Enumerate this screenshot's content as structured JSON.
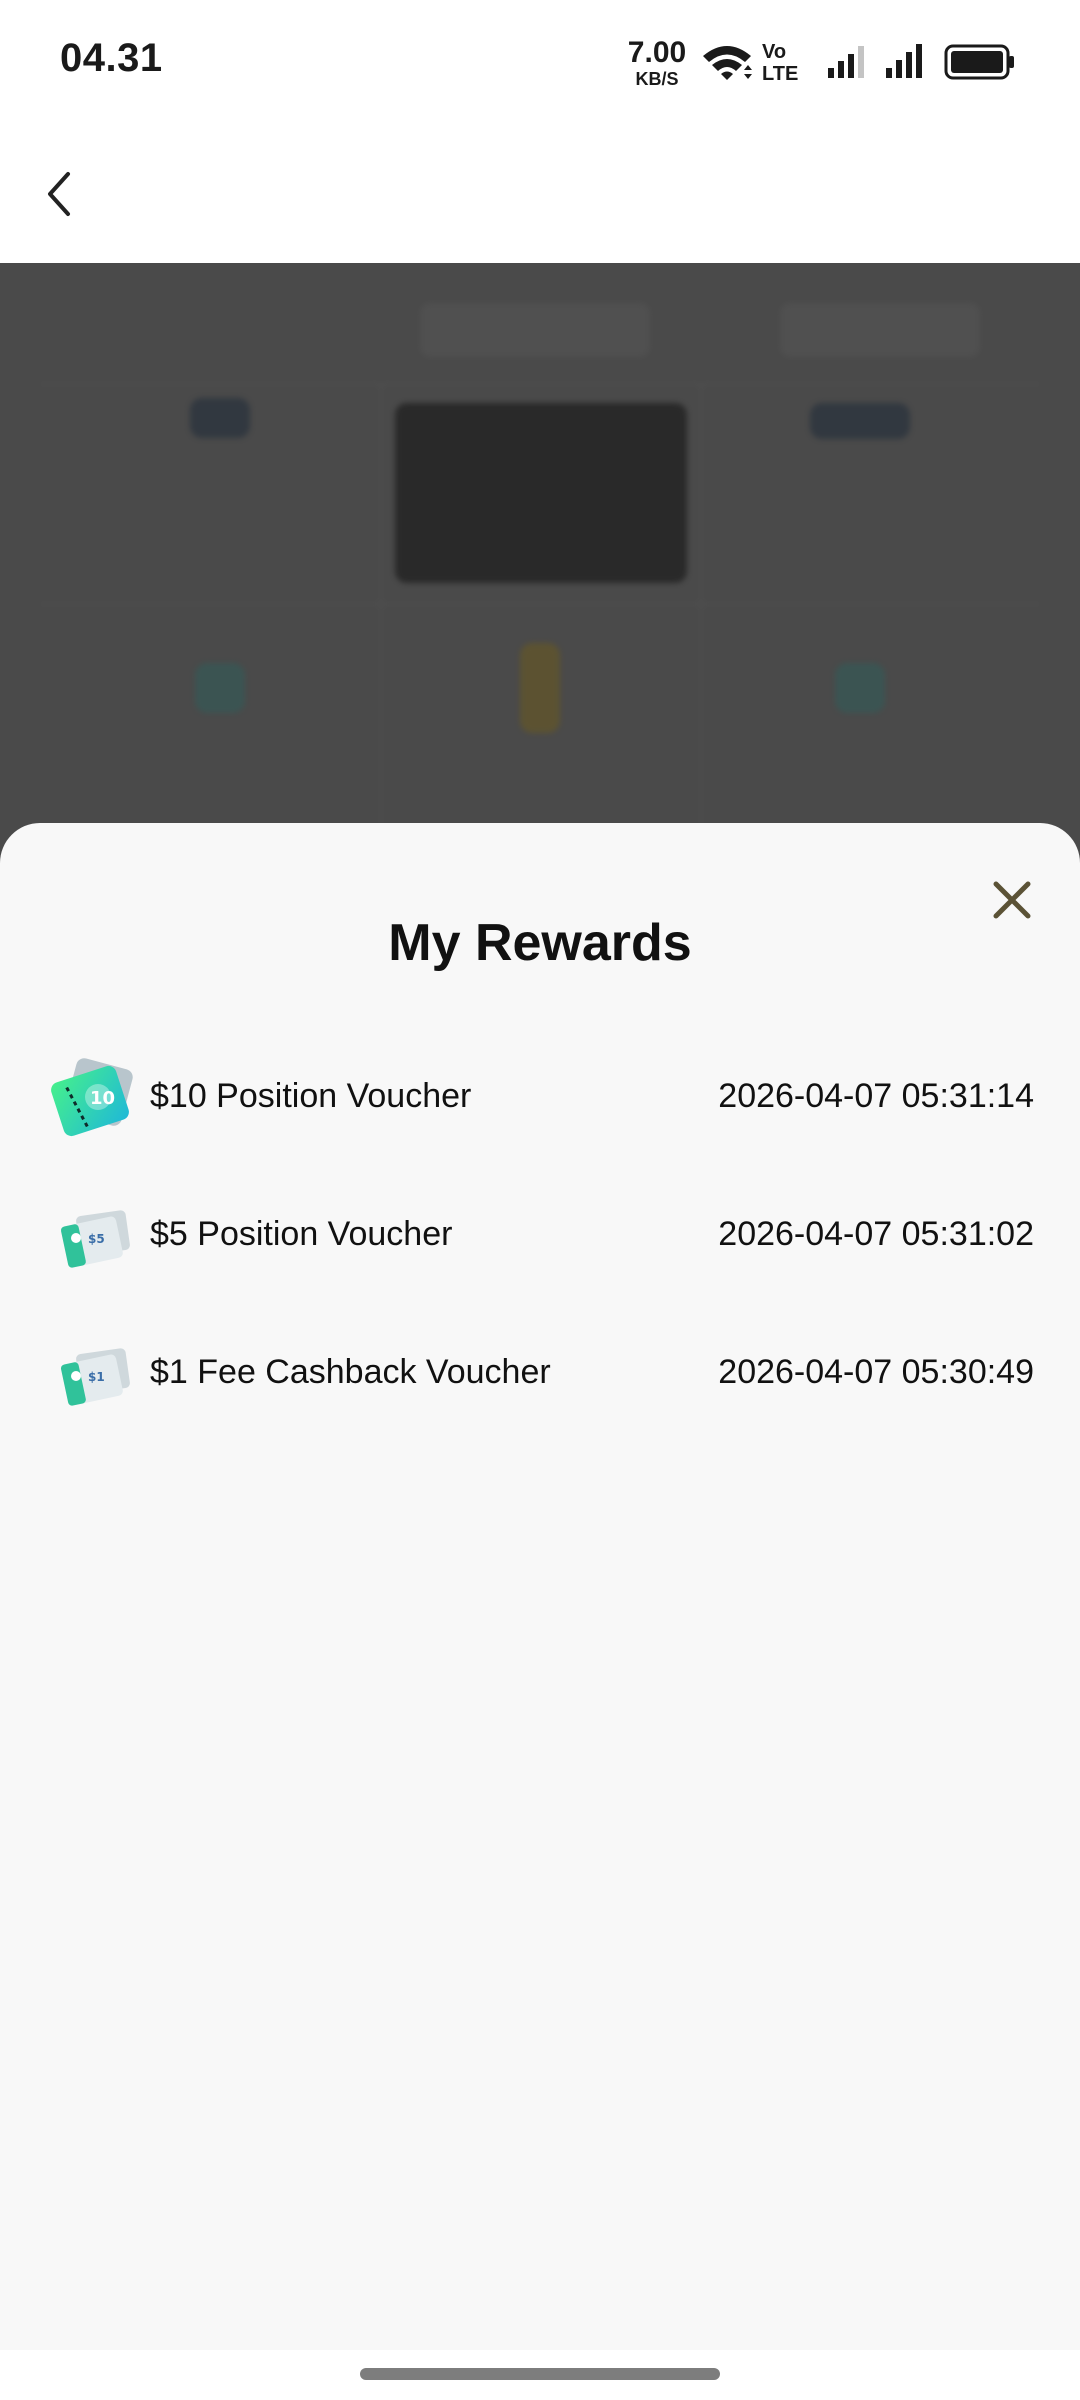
{
  "status_bar": {
    "time": "04.31",
    "net_speed_value": "7.00",
    "net_speed_unit": "KB/S",
    "volte_top": "Vo",
    "volte_bottom": "LTE",
    "icons": [
      "wifi-icon",
      "signal-icon",
      "signal-icon",
      "battery-icon"
    ]
  },
  "header": {
    "back_icon": "chevron-left-icon"
  },
  "sheet": {
    "title": "My Rewards",
    "close_icon": "close-icon",
    "rewards": [
      {
        "name": "$10 Position Voucher",
        "time": "2026-04-07 05:31:14",
        "icon": "voucher-10-icon"
      },
      {
        "name": "$5 Position Voucher",
        "time": "2026-04-07 05:31:02",
        "icon": "voucher-5-icon"
      },
      {
        "name": "$1 Fee Cashback Voucher",
        "time": "2026-04-07 05:30:49",
        "icon": "voucher-cashback-icon"
      }
    ]
  },
  "colors": {
    "overlay": "#4a4a4a",
    "sheet_bg": "#f8f8f8",
    "close_icon": "#5b5236",
    "voucher_primary": "#2fd8a4",
    "voucher_light": "#dfe7ea"
  }
}
